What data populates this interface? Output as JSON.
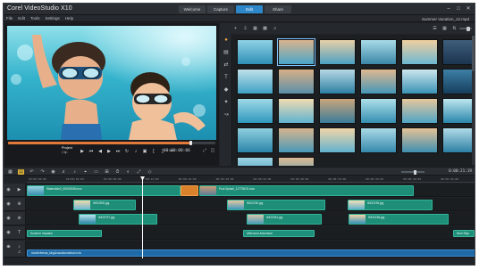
{
  "app": {
    "title": "Corel VideoStudio X10"
  },
  "top_tabs": [
    {
      "label": "Welcome"
    },
    {
      "label": "Capture"
    },
    {
      "label": "Edit"
    },
    {
      "label": "Share"
    }
  ],
  "menu": [
    {
      "label": "File"
    },
    {
      "label": "Edit"
    },
    {
      "label": "Tools"
    },
    {
      "label": "Settings"
    },
    {
      "label": "Help"
    }
  ],
  "project_name": "Summer Vacation_12.mpd",
  "player": {
    "mode_labels": [
      "Project",
      "Clip"
    ],
    "timecode": "00:00:08:06",
    "progress": 0.88
  },
  "timeline": {
    "timecode": "0:00:21:19",
    "ruler": [
      "00:00:00:00",
      "00:00:04:00",
      "00:00:08:00",
      "00:00:12:00",
      "00:00:16:00",
      "00:00:20:00",
      "00:00:24:00",
      "00:00:28:00",
      "00:00:32:00",
      "00:00:36:00",
      "00:00:40:00",
      "00:00:44:00"
    ],
    "video_track": [
      {
        "label": "Waterslide2_00002008.mov"
      },
      {
        "label": ""
      },
      {
        "label": "Pool Splash_1177361S.mov"
      }
    ],
    "overlay1": [
      {
        "label": "IMG2500.jpg"
      },
      {
        "label": "IMG2230.jpg"
      },
      {
        "label": "IMG2195.jpg"
      }
    ],
    "overlay2": [
      {
        "label": "IMG0767.jpg"
      },
      {
        "label": "IMG2061.jpg"
      },
      {
        "label": "IMG0238.jpg"
      }
    ],
    "title_track": [
      {
        "label": "Summer Vacation"
      },
      {
        "label": "Afternoon Adventure"
      },
      {
        "label": "Next Step"
      }
    ],
    "audio_track": [
      {
        "label": "shutterfeesta_king&vacationalstral.m4a"
      }
    ]
  }
}
